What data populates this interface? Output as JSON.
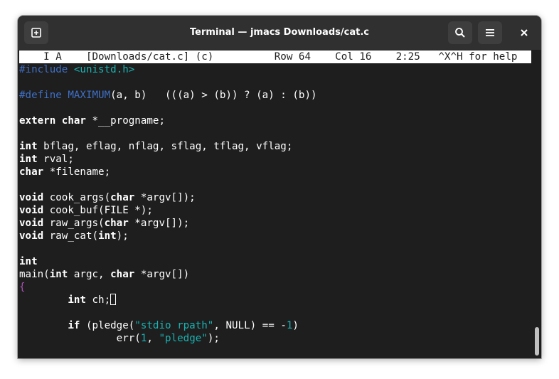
{
  "window": {
    "title": "Terminal — jmacs Downloads/cat.c"
  },
  "titlebar": {
    "new_tab_icon": "new-tab-icon",
    "search_icon": "search-icon",
    "menu_icon": "hamburger-menu-icon",
    "close_icon": "close-icon"
  },
  "status_line": "    I A    [Downloads/cat.c] (c)          Row 64    Col 16    2:25   ^X^H for help",
  "code": [
    [
      {
        "t": "#include ",
        "c": "pp"
      },
      {
        "t": "<unistd.h>",
        "c": "inc"
      }
    ],
    [],
    [
      {
        "t": "#define ",
        "c": "pp"
      },
      {
        "t": "MAXIMUM",
        "c": "pp"
      },
      {
        "t": "(a, b)   (((a) > (b)) ? (a) : (b))",
        "c": ""
      }
    ],
    [],
    [
      {
        "t": "extern",
        "c": "kw"
      },
      {
        "t": " ",
        "c": ""
      },
      {
        "t": "char",
        "c": "kw"
      },
      {
        "t": " *__progname;",
        "c": ""
      }
    ],
    [],
    [
      {
        "t": "int",
        "c": "kw"
      },
      {
        "t": " bflag, eflag, nflag, sflag, tflag, vflag;",
        "c": ""
      }
    ],
    [
      {
        "t": "int",
        "c": "kw"
      },
      {
        "t": " rval;",
        "c": ""
      }
    ],
    [
      {
        "t": "char",
        "c": "kw"
      },
      {
        "t": " *filename;",
        "c": ""
      }
    ],
    [],
    [
      {
        "t": "void",
        "c": "kw"
      },
      {
        "t": " cook_args(",
        "c": ""
      },
      {
        "t": "char",
        "c": "kw"
      },
      {
        "t": " *argv[]);",
        "c": ""
      }
    ],
    [
      {
        "t": "void",
        "c": "kw"
      },
      {
        "t": " cook_buf(FILE *);",
        "c": ""
      }
    ],
    [
      {
        "t": "void",
        "c": "kw"
      },
      {
        "t": " raw_args(",
        "c": ""
      },
      {
        "t": "char",
        "c": "kw"
      },
      {
        "t": " *argv[]);",
        "c": ""
      }
    ],
    [
      {
        "t": "void",
        "c": "kw"
      },
      {
        "t": " raw_cat(",
        "c": ""
      },
      {
        "t": "int",
        "c": "kw"
      },
      {
        "t": ");",
        "c": ""
      }
    ],
    [],
    [
      {
        "t": "int",
        "c": "kw"
      }
    ],
    [
      {
        "t": "main(",
        "c": ""
      },
      {
        "t": "int",
        "c": "kw"
      },
      {
        "t": " argc, ",
        "c": ""
      },
      {
        "t": "char",
        "c": "kw"
      },
      {
        "t": " *argv[])",
        "c": ""
      }
    ],
    [
      {
        "t": "{",
        "c": "brace"
      }
    ],
    [
      {
        "t": "        ",
        "c": ""
      },
      {
        "t": "int",
        "c": "kw"
      },
      {
        "t": " ch;",
        "c": ""
      },
      {
        "t": "",
        "c": "cursor"
      }
    ],
    [],
    [
      {
        "t": "        ",
        "c": ""
      },
      {
        "t": "if",
        "c": "kw"
      },
      {
        "t": " (pledge(",
        "c": ""
      },
      {
        "t": "\"stdio rpath\"",
        "c": "str"
      },
      {
        "t": ", NULL) == -",
        "c": ""
      },
      {
        "t": "1",
        "c": "num"
      },
      {
        "t": ")",
        "c": ""
      }
    ],
    [
      {
        "t": "                err(",
        "c": ""
      },
      {
        "t": "1",
        "c": "num"
      },
      {
        "t": ", ",
        "c": ""
      },
      {
        "t": "\"pledge\"",
        "c": "str"
      },
      {
        "t": ");",
        "c": ""
      }
    ]
  ]
}
